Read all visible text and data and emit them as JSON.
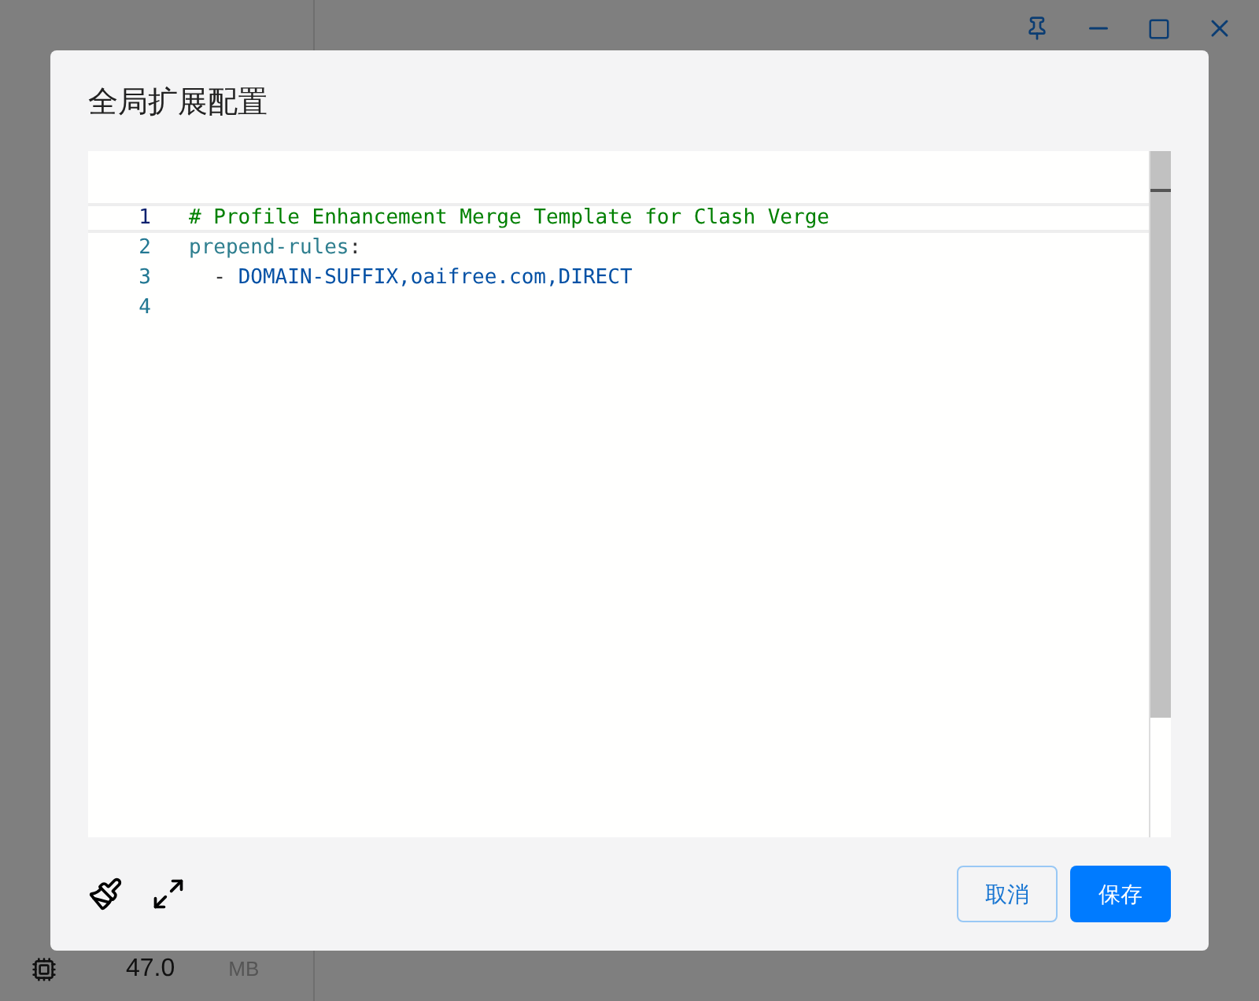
{
  "background": {
    "memory": {
      "value": "47.0",
      "unit": "MB"
    }
  },
  "dialog": {
    "title": "全局扩展配置",
    "editor": {
      "lines": [
        {
          "number": "1",
          "active": true,
          "tokens": [
            {
              "kind": "comment",
              "text": "# Profile Enhancement Merge Template for Clash Verge"
            }
          ]
        },
        {
          "number": "2",
          "active": false,
          "tokens": [
            {
              "kind": "key",
              "text": "prepend-rules"
            },
            {
              "kind": "punct",
              "text": ":"
            }
          ]
        },
        {
          "number": "3",
          "active": false,
          "tokens": [
            {
              "kind": "punct",
              "text": "  - "
            },
            {
              "kind": "value",
              "text": "DOMAIN-SUFFIX,oaifree.com,DIRECT"
            }
          ]
        },
        {
          "number": "4",
          "active": false
        }
      ]
    },
    "buttons": [
      {
        "kind": "secondary",
        "label": "取消"
      },
      {
        "kind": "primary",
        "label": "保存"
      }
    ]
  }
}
